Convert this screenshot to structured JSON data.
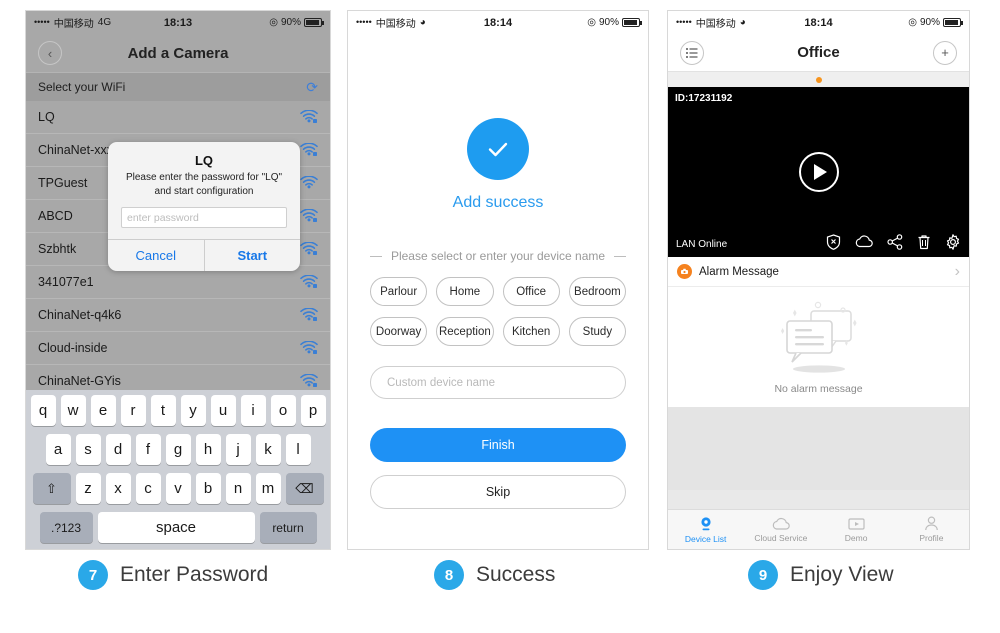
{
  "colors": {
    "accent_blue": "#1e91f5",
    "badge_blue": "#2aa8e8",
    "link_blue": "#1878e8",
    "orange": "#f5821f",
    "panel_gray": "#a8a8a8",
    "keyboard_bg": "#cdd0d6"
  },
  "panel7": {
    "status": {
      "dots": "•••••",
      "carrier": "中国移动",
      "network": "4G",
      "time": "18:13",
      "battery": "90%",
      "alarm_icon": "alarm-clock-icon"
    },
    "nav": {
      "back_icon": "‹",
      "title": "Add a Camera"
    },
    "wifi_header": {
      "label": "Select your WiFi",
      "refresh_icon": "⟳"
    },
    "wifi_list": [
      {
        "ssid": "LQ",
        "secured": true
      },
      {
        "ssid": "ChinaNet-xxx",
        "secured": true
      },
      {
        "ssid": "TPGuest",
        "secured": false
      },
      {
        "ssid": "ABCD",
        "secured": true
      },
      {
        "ssid": "Szbhtk",
        "secured": true
      },
      {
        "ssid": "341077e1",
        "secured": true
      },
      {
        "ssid": "ChinaNet-q4k6",
        "secured": true
      },
      {
        "ssid": "Cloud-inside",
        "secured": true
      },
      {
        "ssid": "ChinaNet-GYis",
        "secured": true
      }
    ],
    "dialog": {
      "title": "LQ",
      "message": "Please enter the password for \"LQ\" and start configuration",
      "input_placeholder": "enter password",
      "input_value": "",
      "cancel_label": "Cancel",
      "start_label": "Start"
    },
    "keyboard": {
      "row1": [
        "q",
        "w",
        "e",
        "r",
        "t",
        "y",
        "u",
        "i",
        "o",
        "p"
      ],
      "row2": [
        "a",
        "s",
        "d",
        "f",
        "g",
        "h",
        "j",
        "k",
        "l"
      ],
      "row3": [
        "z",
        "x",
        "c",
        "v",
        "b",
        "n",
        "m"
      ],
      "shift_icon": "⇧",
      "backspace_icon": "⌫",
      "numbers_label": ".?123",
      "space_label": "space",
      "return_label": "return"
    }
  },
  "panel8": {
    "status": {
      "dots": "•••••",
      "carrier": "中国移动",
      "network": "wifi-icon",
      "time": "18:14",
      "battery": "90%"
    },
    "success_icon": "check-circle-icon",
    "success_label": "Add success",
    "prompt": "Please select or enter your device name",
    "chips_row1": [
      "Parlour",
      "Home",
      "Office",
      "Bedroom"
    ],
    "chips_row2": [
      "Doorway",
      "Reception",
      "Kitchen",
      "Study"
    ],
    "custom_placeholder": "Custom device name",
    "custom_value": "",
    "finish_label": "Finish",
    "skip_label": "Skip"
  },
  "panel9": {
    "status": {
      "dots": "•••••",
      "carrier": "中国移动",
      "network": "wifi-icon",
      "time": "18:14",
      "battery": "90%"
    },
    "nav": {
      "menu_icon": "list-icon",
      "title": "Office",
      "add_icon": "+"
    },
    "video": {
      "device_id": "ID:17231192",
      "status_text": "LAN Online",
      "play_icon": "play-icon",
      "toolbar_icons": [
        "shield-off-icon",
        "cloud-icon",
        "share-icon",
        "trash-icon",
        "gear-icon"
      ]
    },
    "alarm": {
      "row_label": "Alarm Message",
      "chevron": "›",
      "empty_label": "No alarm message",
      "empty_icon": "chat-bubbles-icon"
    },
    "tabs": [
      {
        "label": "Device List",
        "icon": "camera-icon",
        "active": true
      },
      {
        "label": "Cloud Service",
        "icon": "cloud-icon",
        "active": false
      },
      {
        "label": "Demo",
        "icon": "video-play-icon",
        "active": false
      },
      {
        "label": "Profile",
        "icon": "person-icon",
        "active": false
      }
    ]
  },
  "captions": [
    {
      "number": "7",
      "label": "Enter Password"
    },
    {
      "number": "8",
      "label": "Success"
    },
    {
      "number": "9",
      "label": "Enjoy View"
    }
  ]
}
